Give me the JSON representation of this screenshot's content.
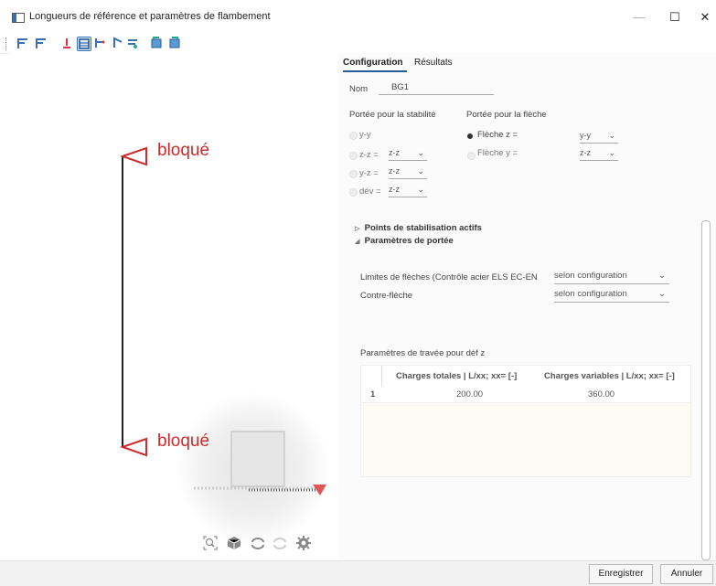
{
  "window": {
    "title": "Longueurs de référence et paramètres de flambement",
    "minimize": "—",
    "maximize": "☐",
    "close": "✕"
  },
  "toolbar": {
    "icons": [
      "member-icon",
      "member-alt-icon",
      "support-icon",
      "table-icon",
      "buckling-icon",
      "span-icon",
      "load-icon",
      "export-icon",
      "import-icon"
    ]
  },
  "viewport": {
    "top_label": "bloqué",
    "bottom_label": "bloqué",
    "tools": [
      "zoom-icon",
      "view-cube-icon",
      "rotate-icon",
      "pan-icon",
      "settings-icon"
    ]
  },
  "tabs": {
    "configuration": "Configuration",
    "resultats": "Résultats"
  },
  "form": {
    "nom_label": "Nom",
    "nom_value": "BG1",
    "stab_header": "Portée pour la stabilité",
    "fleche_header": "Portée pour la flèche",
    "stab_rows": [
      {
        "label": "y-y",
        "value": ""
      },
      {
        "label": "z-z =",
        "value": "z-z"
      },
      {
        "label": "y-z =",
        "value": "z-z"
      },
      {
        "label": "dév =",
        "value": "z-z"
      }
    ],
    "fleche_rows": [
      {
        "label": "Flèche z =",
        "value": "y-y",
        "selected": true
      },
      {
        "label": "Flèche y =",
        "value": "z-z",
        "selected": false
      }
    ]
  },
  "sections": {
    "points": "Points de stabilisation actifs",
    "params": "Paramètres de portée"
  },
  "limits": {
    "label1": "Limites de flèches (Contrôle acier ELS EC-EN",
    "value1": "selon configuration",
    "label2": "Contre-flèche",
    "value2": "selon configuration"
  },
  "table": {
    "caption": "Paramètres de travée pour déf z",
    "headers": [
      "",
      "Charges totales | L/xx; xx= [-]",
      "Charges variables | L/xx; xx= [-]"
    ],
    "rows": [
      [
        "1",
        "200.00",
        "360.00"
      ]
    ]
  },
  "buttons": {
    "save": "Enregistrer",
    "cancel": "Annuler"
  }
}
